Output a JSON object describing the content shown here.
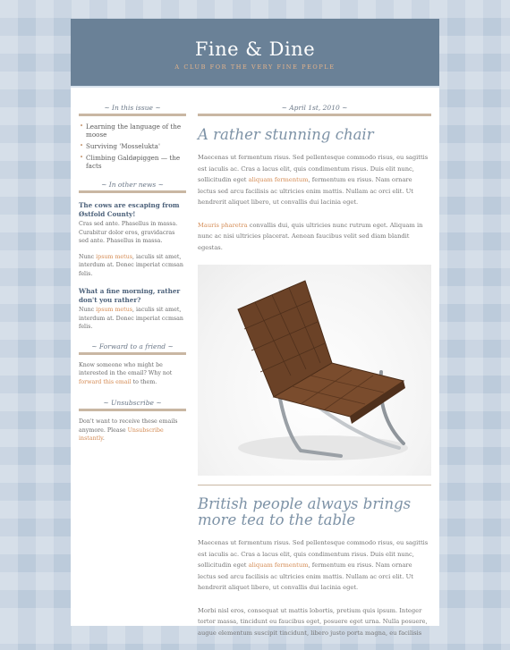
{
  "header": {
    "title": "Fine & Dine",
    "tagline": "A CLUB FOR THE VERY FINE PEOPLE"
  },
  "sidebar": {
    "in_this_issue": {
      "heading": "~ In this issue ~",
      "items": [
        "Learning the language of the moose",
        "Surviving 'Mosselukta'",
        "Climbing Galdøpiggen — the facts"
      ]
    },
    "other_news": {
      "heading": "~ In other news ~",
      "story1_title": "The cows are escaping from Østfold County!",
      "story1_p1": "Cras sed ante. Phasellus in massa. Curabitur dolor eros, gravidacras sed ante. Phasellus in massa.",
      "story1_p2_pre": "Nunc ",
      "story1_p2_link": "ipsum metus",
      "story1_p2_post": ", iaculis sit amet, interdum at. Donec imperiat ccmsan felis.",
      "story2_title": "What a fine morning, rather don't you rather?",
      "story2_p_pre": "Nunc ",
      "story2_p_link": "ipsum metus",
      "story2_p_post": ", iaculis sit amet, interdum at. Donec imperiat ccmsan felis."
    },
    "forward": {
      "heading": "~ Forward to a friend ~",
      "text_pre": "Know someone who might be interested in the email? Why not ",
      "link": "forward this email",
      "text_post": " to them."
    },
    "unsubscribe": {
      "heading": "~ Unsubscribe ~",
      "text_pre": "Don't want to receive these emails anymore. Please ",
      "link": "Unsubscribe instantly",
      "text_post": "."
    }
  },
  "main": {
    "date": "~ April 1st, 2010 ~",
    "article1": {
      "title": "A rather stunning chair",
      "p1_pre": "Maecenas ut fermentum risus. Sed pellentesque commodo risus, eu sagittis est iaculis ac. Cras a lacus elit, quis condimentum risus. Duis elit nunc, sollicitudin eget ",
      "p1_link": "aliquam fermentum",
      "p1_post": ", fermentum eu risus. Nam ornare lectus sed arcu facilisis ac ultricies enim mattis. Nullam ac orci elit. Ut hendrerit aliquet libero, ut convallis dui lacinia eget.",
      "p2_link": "Mauris pharetra",
      "p2_post": " convallis dui, quis ultricies nunc rutrum eget. Aliquam in nunc ac nisi ultricies placerat. Aenean faucibus velit sed diam blandit egestas."
    },
    "article2": {
      "title": "British people always brings more tea to the table",
      "p1_pre": "Maecenas ut fermentum risus. Sed pellentesque commodo risus, eu sagittis est iaculis ac. Cras a lacus elit, quis condimentum risus. Duis elit nunc, sollicitudin eget ",
      "p1_link": "aliquam fermentum",
      "p1_post": ", fermentum eu risus. Nam ornare lectus sed arcu facilisis ac ultricies enim mattis. Nullam ac orci elit. Ut hendrerit aliquet libero, ut convallis dui lacinia eget.",
      "p2": "Morbi nisl eros, consequat ut mattis lobortis, pretium quis ipsum. Integer tortor massa, tincidunt eu faucibus eget, posuere eget urna. Nulla posuere, augue elementum suscipit tincidunt, libero justo porta magna, eu facilisis"
    }
  },
  "colors": {
    "page_bg": "#bccbdb",
    "header_bg": "#6a8197",
    "accent_link": "#d48b54",
    "section_rule": "#c9b7a3",
    "heading_blue": "#7d92a6"
  }
}
